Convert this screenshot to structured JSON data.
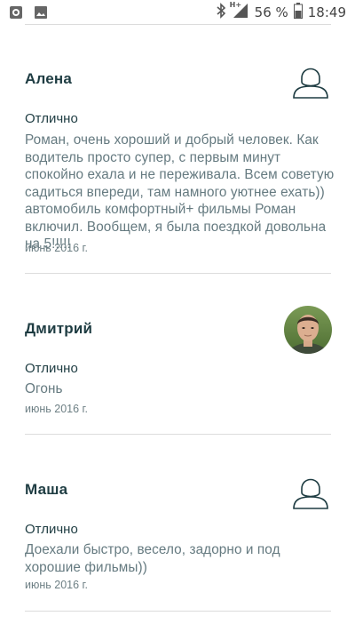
{
  "status_bar": {
    "time": "18:49",
    "battery": "56 %",
    "network": "H+"
  },
  "reviews": [
    {
      "name": "Алена",
      "rating": "Отлично",
      "text": "Роман, очень хороший и добрый человек. Как водитель просто супер, с первым минут спокойно ехала и не переживала. Всем советую садиться впереди, там намного уютнее ехать)) автомобиль комфортный+ фильмы Роман включил. Вообщем, я была поездкой довольна на 5!!!!!",
      "date": "июнь 2016 г.",
      "avatar": "default-user-icon"
    },
    {
      "name": "Дмитрий",
      "rating": "Отлично",
      "text": "Огонь",
      "date": "июнь 2016 г.",
      "avatar": "photo"
    },
    {
      "name": "Маша",
      "rating": "Отлично",
      "text": "Доехали быстро, весело, задорно и под хорошие фильмы))",
      "date": "июнь 2016 г.",
      "avatar": "default-user-icon"
    }
  ],
  "colors": {
    "name": "#1e3c42",
    "text": "#657a80",
    "divider": "#dcdcdc"
  }
}
